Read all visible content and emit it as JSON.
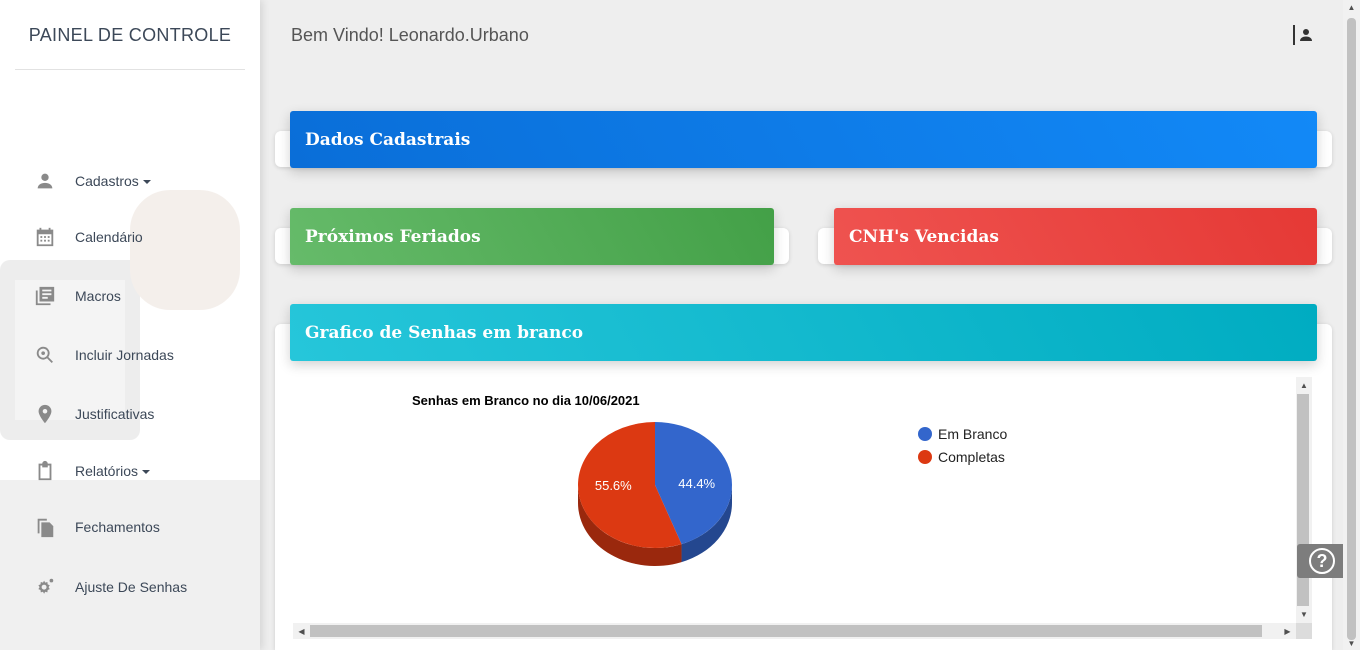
{
  "sidebar": {
    "brand": "PAINEL DE CONTROLE",
    "items": [
      {
        "label": "Cadastros",
        "icon": "person-icon",
        "dropdown": true
      },
      {
        "label": "Calendário",
        "icon": "calendar-icon",
        "dropdown": false
      },
      {
        "label": "Macros",
        "icon": "library-books-icon",
        "dropdown": false
      },
      {
        "label": "Incluir Jornadas",
        "icon": "search-location-icon",
        "dropdown": false
      },
      {
        "label": "Justificativas",
        "icon": "location-pin-icon",
        "dropdown": false
      },
      {
        "label": "Relatórios",
        "icon": "clipboard-icon",
        "dropdown": true
      },
      {
        "label": "Fechamentos",
        "icon": "file-copy-icon",
        "dropdown": false
      },
      {
        "label": "Ajuste De Senhas",
        "icon": "settings-icon",
        "dropdown": false
      }
    ]
  },
  "header": {
    "welcome": "Bem Vindo! Leonardo.Urbano"
  },
  "cards": {
    "dados": "Dados Cadastrais",
    "feriados": "Próximos Feriados",
    "cnh": "CNH's Vencidas",
    "grafico": "Grafico de Senhas em branco"
  },
  "colors": {
    "blue_header": "#0a6ed8",
    "green_header": "#4caf50",
    "red_header": "#e53935",
    "cyan_header": "#00acc1",
    "em_branco": "#3366cc",
    "completas": "#dc3912"
  },
  "chart_data": {
    "type": "pie",
    "title": "Senhas em Branco no dia 10/06/2021",
    "legend_position": "right",
    "slices": [
      {
        "label": "Em Branco",
        "value": 44.4,
        "display": "44.4%",
        "color": "#3366cc"
      },
      {
        "label": "Completas",
        "value": 55.6,
        "display": "55.6%",
        "color": "#dc3912"
      }
    ]
  }
}
